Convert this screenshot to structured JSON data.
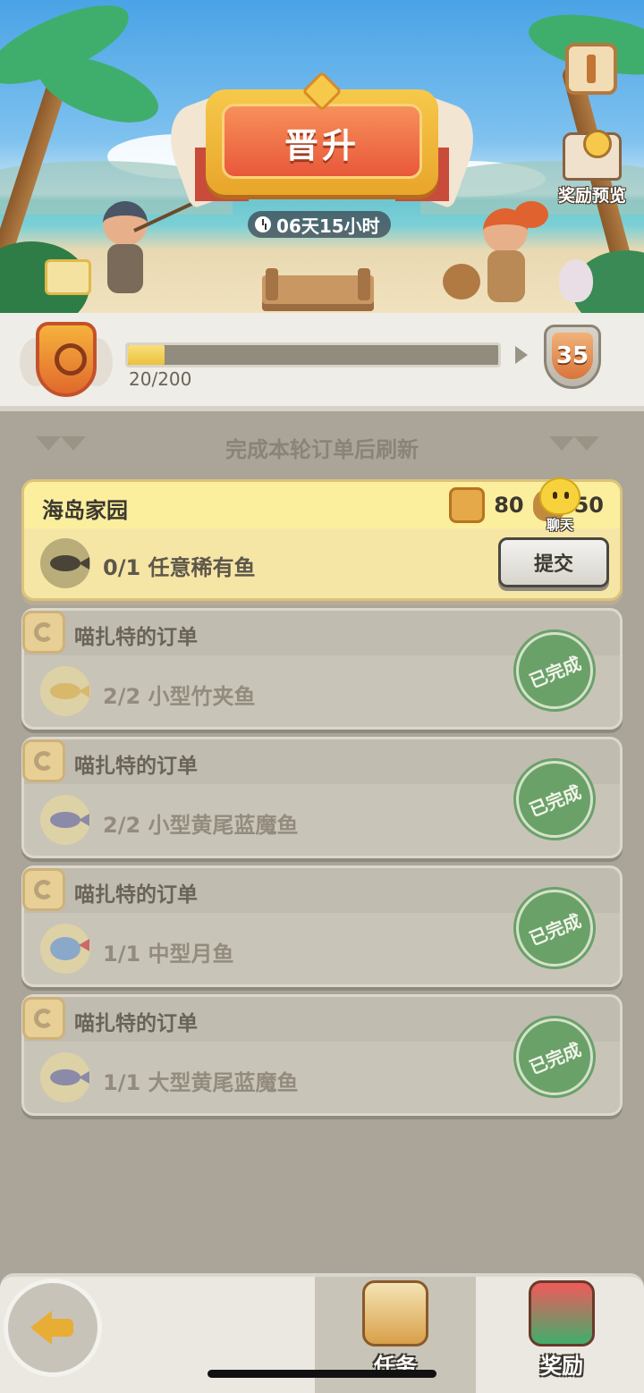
{
  "banner": {
    "title": "晋升",
    "timer": "06天15小时",
    "reward_preview_label": "奖励预览"
  },
  "progress": {
    "current": 20,
    "max": 200,
    "fraction": 0.1,
    "text": "20/200",
    "next_level": "35"
  },
  "orders": {
    "refresh_hint": "完成本轮订单后刷新",
    "active": {
      "name": "海岛家园",
      "reward_coin": "80",
      "reward_bag": "50",
      "item": "0/1 任意稀有鱼",
      "submit_label": "提交",
      "chat_label": "聊天"
    },
    "completed": [
      {
        "title": "喵扎特的订单",
        "item": "2/2 小型竹夹鱼",
        "status": "已完成"
      },
      {
        "title": "喵扎特的订单",
        "item": "2/2 小型黄尾蓝魔鱼",
        "status": "已完成"
      },
      {
        "title": "喵扎特的订单",
        "item": "1/1 中型月鱼",
        "status": "已完成"
      },
      {
        "title": "喵扎特的订单",
        "item": "1/1 大型黄尾蓝魔鱼",
        "status": "已完成"
      }
    ]
  },
  "nav": {
    "tab_task": "任务",
    "tab_reward": "奖励",
    "active_tab": "任务"
  },
  "colors": {
    "accent": "#ecc13c",
    "done_green": "#6aa169",
    "background": "#aaa598"
  }
}
